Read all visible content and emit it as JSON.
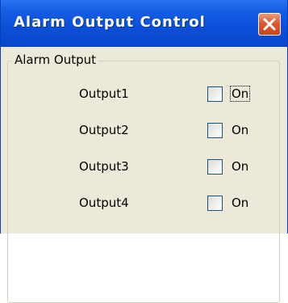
{
  "window": {
    "title": "Alarm Output Control"
  },
  "group": {
    "label": "Alarm Output"
  },
  "outputs": [
    {
      "label": "Output1",
      "checkbox_label": "On",
      "checked": false,
      "focused": true
    },
    {
      "label": "Output2",
      "checkbox_label": "On",
      "checked": false,
      "focused": false
    },
    {
      "label": "Output3",
      "checkbox_label": "On",
      "checked": false,
      "focused": false
    },
    {
      "label": "Output4",
      "checkbox_label": "On",
      "checked": false,
      "focused": false
    }
  ],
  "icons": {
    "close": "close-icon"
  },
  "colors": {
    "titlebar": "#0b4fd8",
    "close_button": "#e2592f",
    "dialog_background": "#ece9d8"
  }
}
